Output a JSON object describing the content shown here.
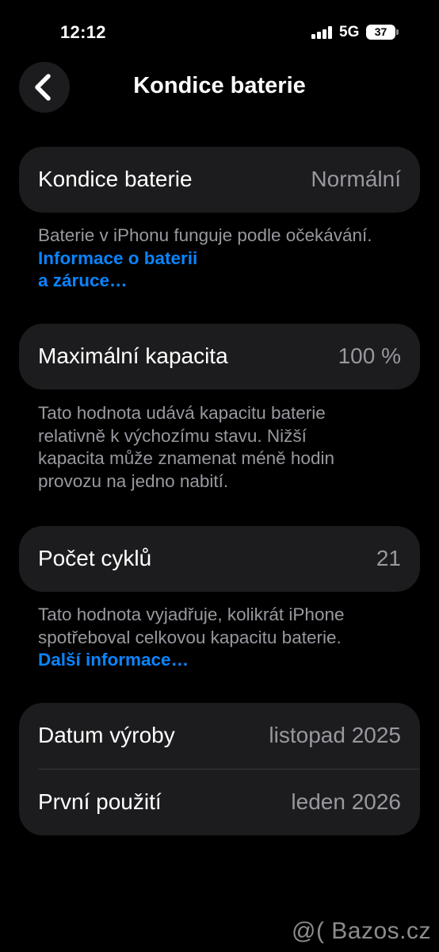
{
  "status_bar": {
    "time": "12:12",
    "network": "5G",
    "battery_level": "37"
  },
  "header": {
    "title": "Kondice baterie"
  },
  "battery_health": {
    "label": "Kondice baterie",
    "value": "Normální",
    "footnote_text": "Baterie v iPhonu funguje podle očekávání.",
    "footnote_link_line1": "Informace o baterii",
    "footnote_link_line2": "a záruce…"
  },
  "max_capacity": {
    "label": "Maximální kapacita",
    "value": "100 %",
    "footnote_line1": "Tato hodnota udává kapacitu baterie",
    "footnote_line2": "relativně k výchozímu stavu. Nižší",
    "footnote_line3": "kapacita může znamenat méně hodin",
    "footnote_line4": "provozu na jedno nabití."
  },
  "cycle_count": {
    "label": "Počet cyklů",
    "value": "21",
    "footnote_line1": "Tato hodnota vyjadřuje, kolikrát iPhone",
    "footnote_line2": "spotřeboval celkovou kapacitu baterie.",
    "footnote_link": "Další informace…"
  },
  "dates": {
    "manufacture_label": "Datum výroby",
    "manufacture_value": "listopad 2025",
    "first_use_label": "První použití",
    "first_use_value": "leden 2026"
  },
  "watermark": "@( Bazos.cz",
  "colors": {
    "background": "#000000",
    "card": "#1c1c1e",
    "secondary_text": "#98989f",
    "link": "#0a84ff"
  }
}
